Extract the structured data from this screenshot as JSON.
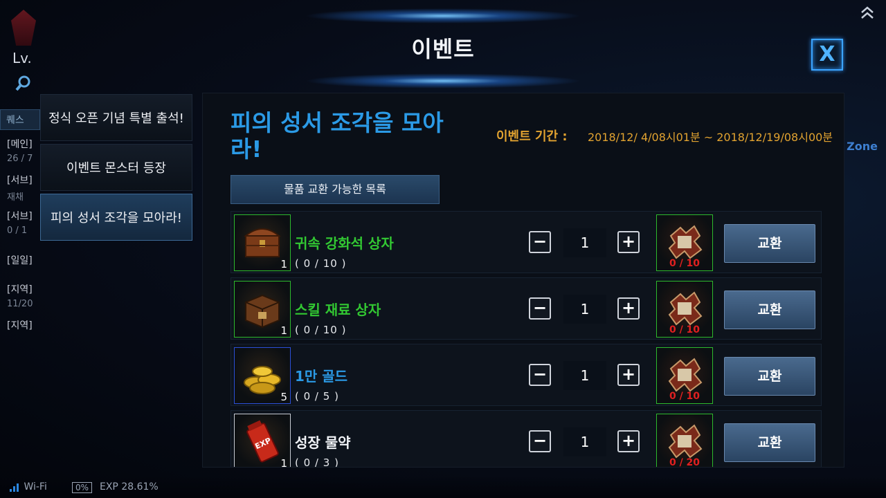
{
  "hud": {
    "level": "Lv.",
    "quest_tab": "퀘스",
    "quests": [
      {
        "label": "[메인]",
        "sub": "26 / 7"
      },
      {
        "label": "[서브]",
        "sub": "재채"
      },
      {
        "label": "[서브]",
        "sub": "0 / 1"
      },
      {
        "label": "[일일]",
        "sub": ""
      },
      {
        "label": "[지역]",
        "sub": "11/20"
      },
      {
        "label": "[지역]",
        "sub": ""
      }
    ],
    "zone": "Zone",
    "wifi": "Wi-Fi",
    "battery": "0%",
    "exp": "EXP 28.61%"
  },
  "dialog": {
    "title": "이벤트",
    "close_label": "X"
  },
  "tabs": [
    {
      "label": "정식 오픈 기념 특별 출석!",
      "active": false
    },
    {
      "label": "이벤트 몬스터 등장",
      "active": false
    },
    {
      "label": "피의 성서 조각을 모아라!",
      "active": true
    }
  ],
  "event": {
    "title": "피의 성서 조각을 모아라!",
    "period_label": "이벤트 기간 :",
    "period_value": "2018/12/ 4/08시01분 ~ 2018/12/19/08시00분",
    "list_header": "물품 교환 가능한 목록"
  },
  "colors": {
    "green_name": "#32c832",
    "blue_name": "#2b9ae6",
    "white_name": "#f2f4f8"
  },
  "items": [
    {
      "name": "귀속 강화석 상자",
      "progress": "( 0 / 10 )",
      "count": "1",
      "qty": "1",
      "cost": "0 / 10",
      "exchange": "교환",
      "icon": "chest-icon",
      "grade": "green"
    },
    {
      "name": "스킬 재료 상자",
      "progress": "( 0 / 10 )",
      "count": "1",
      "qty": "1",
      "cost": "0 / 10",
      "exchange": "교환",
      "icon": "box-icon",
      "grade": "green"
    },
    {
      "name": "1만 골드",
      "progress": "( 0 / 5 )",
      "count": "5",
      "qty": "1",
      "cost": "0 / 10",
      "exchange": "교환",
      "icon": "gold-coins-icon",
      "grade": "blue"
    },
    {
      "name": "성장 물약",
      "progress": "( 0 / 3 )",
      "count": "1",
      "qty": "1",
      "cost": "0 / 20",
      "exchange": "교환",
      "icon": "exp-potion-icon",
      "grade": "white"
    }
  ]
}
